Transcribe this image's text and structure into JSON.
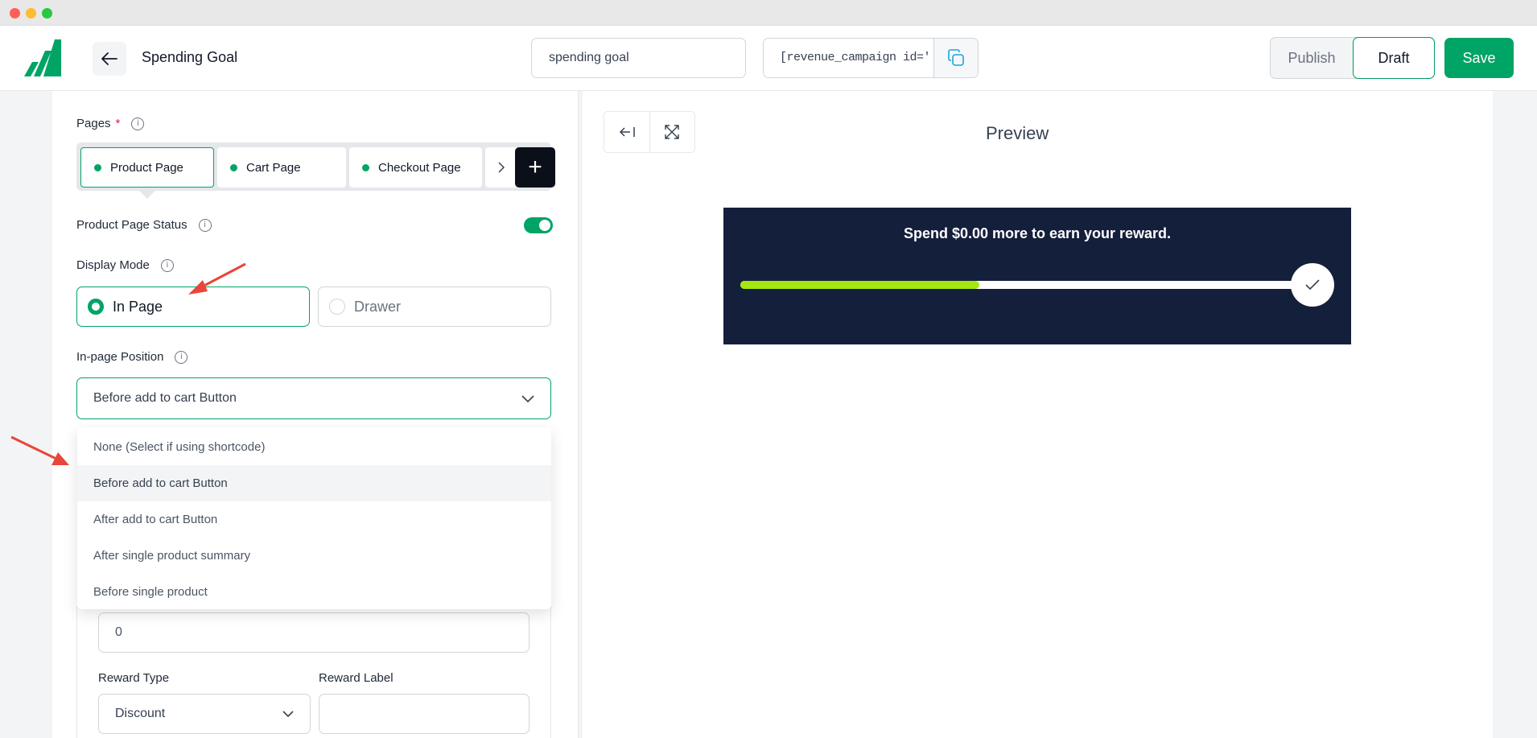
{
  "header": {
    "title": "Spending Goal",
    "campaign_name": "spending goal",
    "shortcode": "[revenue_campaign id='",
    "publish_label": "Publish",
    "draft_label": "Draft",
    "save_label": "Save"
  },
  "form": {
    "pages_label": "Pages",
    "required_mark": "*",
    "pages": [
      {
        "label": "Product Page",
        "active": true
      },
      {
        "label": "Cart Page",
        "active": false
      },
      {
        "label": "Checkout Page",
        "active": false
      }
    ],
    "add_page_symbol": "+",
    "page_status_label": "Product Page Status",
    "page_status_on": true,
    "display_mode_label": "Display Mode",
    "display_modes": [
      {
        "label": "In Page",
        "selected": true
      },
      {
        "label": "Drawer",
        "selected": false
      }
    ],
    "position_label": "In-page Position",
    "position_selected": "Before add to cart Button",
    "position_options": [
      "None (Select if using shortcode)",
      "Before add to cart Button",
      "After add to cart Button",
      "After single product summary",
      "Before single product"
    ],
    "goal_value": "0",
    "reward_type_label": "Reward Type",
    "reward_type_value": "Discount",
    "reward_label_label": "Reward Label",
    "reward_label_value": ""
  },
  "preview": {
    "title": "Preview",
    "message": "Spend $0.00 more to earn your reward.",
    "progress": 0.43
  },
  "colors": {
    "accent": "#00a464",
    "campaign_bg": "#141f3b",
    "progress_fill": "#a3e80f",
    "annotation_arrow": "#e8463a"
  },
  "icons": [
    "back-arrow-icon",
    "copy-icon",
    "info-icon",
    "chevron-right-icon",
    "plus-icon",
    "chevron-down-icon",
    "collapse-left-icon",
    "expand-icon",
    "check-icon"
  ]
}
